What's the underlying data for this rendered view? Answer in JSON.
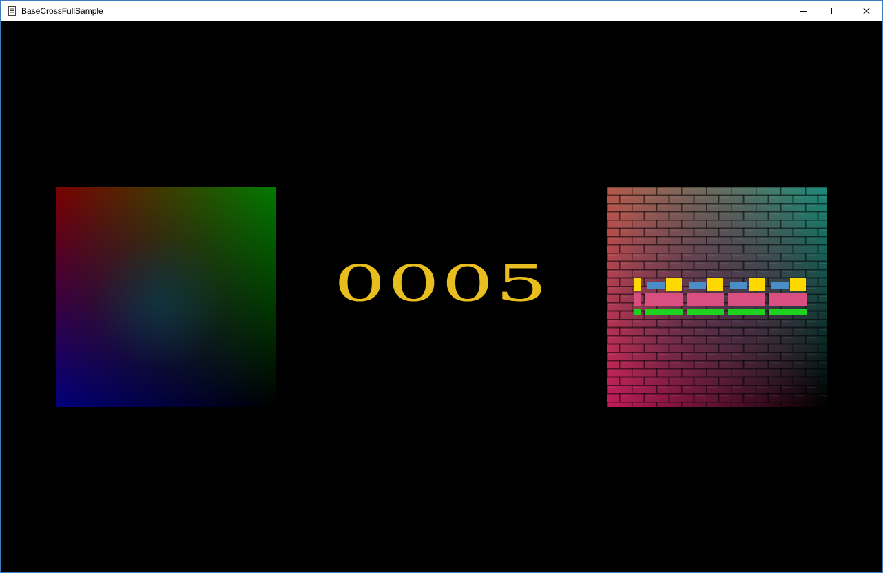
{
  "window": {
    "title": "BaseCrossFullSample",
    "icon": "document-icon",
    "border_color": "#3b7bbf",
    "controls": {
      "minimize_icon": "minimize-icon",
      "maximize_icon": "maximize-icon",
      "close_icon": "close-icon"
    }
  },
  "scene": {
    "background_color": "#000000",
    "left_panel": {
      "kind": "vertex-color gradient square",
      "corner_colors": {
        "top_left": "#7a0000",
        "top_right": "#007a00",
        "bottom_left": "#00007a",
        "bottom_right": "#000000"
      }
    },
    "score": {
      "value": "0005",
      "color": "#e7bd1f"
    },
    "right_panel": {
      "kind": "brick-textured square",
      "tint_colors": {
        "top_left": "#b35a4a",
        "top_right": "#1e8a7a",
        "bottom_left": "#c01c5a",
        "bottom_right": "#000000"
      },
      "pattern_colors": {
        "yellow": "#ffd800",
        "blue": "#4a8ec8",
        "pink": "#d94f7f",
        "green": "#1fd21f"
      }
    }
  }
}
